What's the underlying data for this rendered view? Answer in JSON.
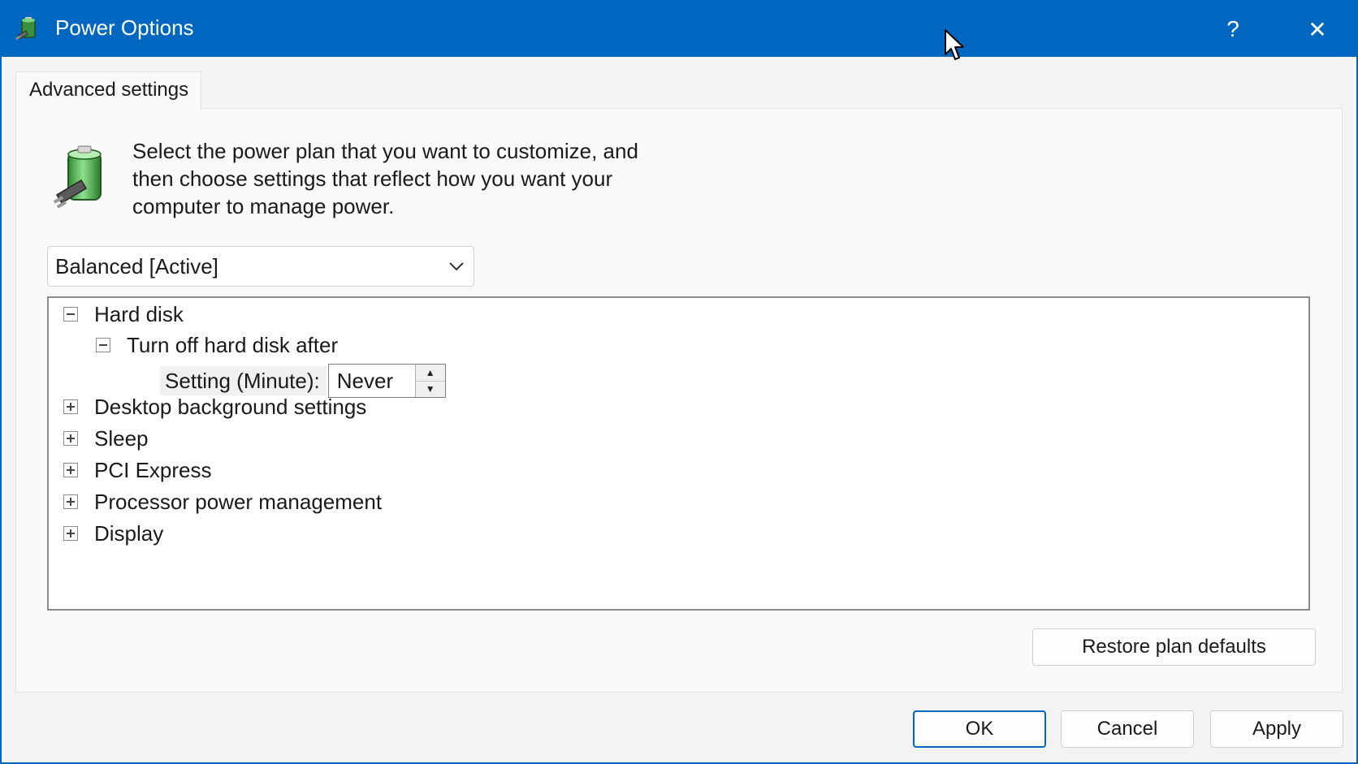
{
  "window": {
    "title": "Power Options",
    "help_glyph": "?",
    "close_glyph": "✕"
  },
  "tab": {
    "label": "Advanced settings"
  },
  "description": "Select the power plan that you want to customize, and then choose settings that reflect how you want your computer to manage power.",
  "plan_select": {
    "value": "Balanced [Active]"
  },
  "tree": {
    "items": [
      {
        "label": "Hard disk",
        "expanded": true
      },
      {
        "label": "Turn off hard disk after",
        "expanded": true
      },
      {
        "label": "Desktop background settings",
        "expanded": false
      },
      {
        "label": "Sleep",
        "expanded": false
      },
      {
        "label": "PCI Express",
        "expanded": false
      },
      {
        "label": "Processor power management",
        "expanded": false
      },
      {
        "label": "Display",
        "expanded": false
      }
    ],
    "setting": {
      "label": "Setting (Minute):",
      "value": "Never"
    }
  },
  "buttons": {
    "restore": "Restore plan defaults",
    "ok": "OK",
    "cancel": "Cancel",
    "apply": "Apply"
  },
  "colors": {
    "titlebar": "#0067c0",
    "accent": "#0067c0",
    "dialog_background": "#f3f3f3"
  },
  "icons": {
    "app": "power-options-icon",
    "battery": "battery-plug-icon",
    "chevron": "chevron-down-icon",
    "cursor": "mouse-pointer-icon"
  }
}
